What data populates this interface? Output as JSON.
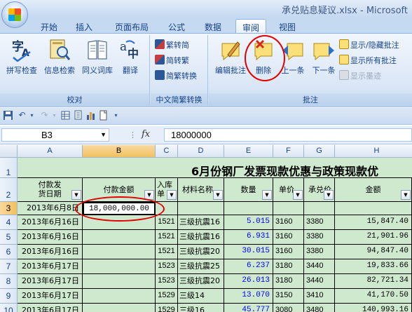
{
  "window": {
    "title": "承兑贴息疑议.xlsx - Microsoft"
  },
  "tabs": [
    {
      "label": "开始"
    },
    {
      "label": "插入"
    },
    {
      "label": "页面布局"
    },
    {
      "label": "公式"
    },
    {
      "label": "数据"
    },
    {
      "label": "审阅",
      "active": true
    },
    {
      "label": "视图"
    }
  ],
  "ribbon": {
    "proofing": {
      "group_label": "校对",
      "buttons": [
        {
          "label": "拼写检查",
          "icon": "spelling-icon"
        },
        {
          "label": "信息检索",
          "icon": "research-icon"
        },
        {
          "label": "同义词库",
          "icon": "thesaurus-icon"
        },
        {
          "label": "翻译",
          "icon": "translate-icon"
        }
      ]
    },
    "chinese": {
      "group_label": "中文简繁转换",
      "buttons": [
        {
          "label": "繁转简",
          "icon": "trad-to-simp-icon"
        },
        {
          "label": "简转繁",
          "icon": "simp-to-trad-icon"
        },
        {
          "label": "简繁转换",
          "icon": "convert-icon"
        }
      ]
    },
    "comments": {
      "group_label": "批注",
      "big_buttons": [
        {
          "label": "编辑批注",
          "icon": "edit-comment-icon"
        },
        {
          "label": "删除",
          "icon": "delete-comment-icon"
        },
        {
          "label": "上一条",
          "icon": "previous-comment-icon"
        },
        {
          "label": "下一条",
          "icon": "next-comment-icon"
        }
      ],
      "small_buttons": [
        {
          "label": "显示/隐藏批注",
          "icon": "show-hide-comment-icon",
          "enabled": true
        },
        {
          "label": "显示所有批注",
          "icon": "show-all-comments-icon",
          "enabled": true
        },
        {
          "label": "显示墨迹",
          "icon": "show-ink-icon",
          "enabled": false
        }
      ]
    }
  },
  "formula_bar": {
    "name_box": "B3",
    "fx_label": "fx",
    "value": "18000000"
  },
  "sheet": {
    "columns": [
      "A",
      "B",
      "C",
      "D",
      "E",
      "F",
      "G",
      "H"
    ],
    "selected_column": "B",
    "selected_row": "3",
    "title": "6月份钢厂发票现款优惠与政策现款优",
    "headers": {
      "A": "付款发\n货日期",
      "B": "付款金额",
      "C": "入库\n单",
      "D": "材料名称",
      "E": "数量",
      "F": "单价",
      "G": "承兑价",
      "H": "金额"
    },
    "rows": [
      {
        "num": "3",
        "A": "2013年6月8日",
        "B": "18,000,000.00",
        "C": "",
        "D": "",
        "E": "",
        "F": "",
        "G": "",
        "H": ""
      },
      {
        "num": "4",
        "A": "2013年6月16日",
        "B": "",
        "C": "1521",
        "D": "三级抗震16",
        "E": "5.015",
        "F": "3160",
        "G": "3380",
        "H": "15,847.40"
      },
      {
        "num": "5",
        "A": "2013年6月16日",
        "B": "",
        "C": "1521",
        "D": "三级抗震16",
        "E": "6.931",
        "F": "3160",
        "G": "3380",
        "H": "21,901.96"
      },
      {
        "num": "6",
        "A": "2013年6月16日",
        "B": "",
        "C": "1521",
        "D": "三级抗震20",
        "E": "30.015",
        "F": "3160",
        "G": "3380",
        "H": "94,847.40"
      },
      {
        "num": "7",
        "A": "2013年6月17日",
        "B": "",
        "C": "1523",
        "D": "三级抗震25",
        "E": "6.237",
        "F": "3180",
        "G": "3440",
        "H": "19,833.66"
      },
      {
        "num": "8",
        "A": "2013年6月17日",
        "B": "",
        "C": "1523",
        "D": "三级抗震20",
        "E": "26.013",
        "F": "3180",
        "G": "3440",
        "H": "82,721.34"
      },
      {
        "num": "9",
        "A": "2013年6月17日",
        "B": "",
        "C": "1529",
        "D": "三级14",
        "E": "13.070",
        "F": "3150",
        "G": "3410",
        "H": "41,170.50"
      },
      {
        "num": "10",
        "A": "2013年6月17日",
        "B": "",
        "C": "1529",
        "D": "三级16",
        "E": "45.777",
        "F": "3080",
        "G": "3480",
        "H": "140,993.16"
      }
    ]
  },
  "colors": {
    "cell_fill": "#cfe9cf",
    "annotation_red": "#e00000",
    "quantity_blue": "#0000ff"
  }
}
